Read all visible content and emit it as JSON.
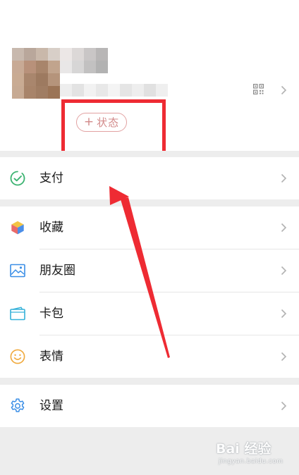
{
  "profile": {
    "status_button": {
      "plus": "+",
      "label": "状态"
    }
  },
  "menu": {
    "pay": {
      "label": "支付"
    },
    "favorites": {
      "label": "收藏"
    },
    "moments": {
      "label": "朋友圈"
    },
    "cards": {
      "label": "卡包"
    },
    "stickers": {
      "label": "表情"
    },
    "settings": {
      "label": "设置"
    }
  },
  "watermark": {
    "brand": "Bai 经验",
    "sub": "jingyan.baidu.com"
  },
  "colors": {
    "annotation_red": "#ee2b33",
    "status_pink": "#d28a8a",
    "section_gap": "#ededed",
    "pay_green": "#3cb371",
    "icon_blue": "#3a8ee6",
    "emoji_orange": "#f0a93c"
  },
  "icons": {
    "profile_qr": "qr-code-icon",
    "profile_chevron": "chevron-right-icon",
    "pay": "pay-check-circle-icon",
    "favorites": "cube-box-icon",
    "moments": "landscape-photo-icon",
    "cards": "card-wallet-icon",
    "stickers": "smiley-face-icon",
    "settings": "gear-icon"
  }
}
